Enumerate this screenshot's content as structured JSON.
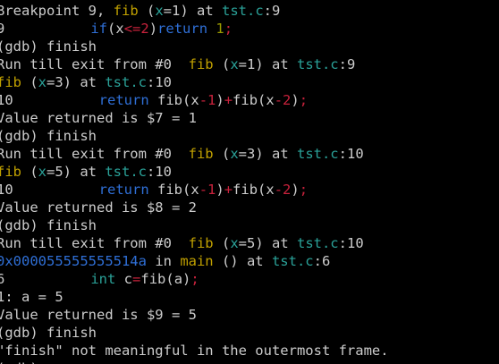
{
  "terminal": {
    "colors": {
      "background": "#000000",
      "default_text": "#cccccc",
      "function_name": "#c0a000",
      "variable": "#2aa198",
      "keyword": "#2f6fd6",
      "operator_number": "#c8223c",
      "number_literal": "#9a9a00"
    },
    "lines": [
      [
        {
          "t": "Breakpoint 9, ",
          "c": "default"
        },
        {
          "t": "fib",
          "c": "yellow"
        },
        {
          "t": " (",
          "c": "default"
        },
        {
          "t": "x",
          "c": "cyan"
        },
        {
          "t": "=1) at ",
          "c": "default"
        },
        {
          "t": "tst.c",
          "c": "cyan"
        },
        {
          "t": ":9",
          "c": "default"
        }
      ],
      [
        {
          "t": "9",
          "c": "default"
        },
        {
          "gap": true
        },
        {
          "t": "if",
          "c": "blue"
        },
        {
          "t": "(",
          "c": "default"
        },
        {
          "t": "x",
          "c": "default"
        },
        {
          "t": "<=2",
          "c": "red"
        },
        {
          "t": ")",
          "c": "default"
        },
        {
          "t": "return",
          "c": "blue"
        },
        {
          "t": " ",
          "c": "default"
        },
        {
          "t": "1",
          "c": "olive"
        },
        {
          "t": ";",
          "c": "red"
        }
      ],
      [
        {
          "t": "(gdb) finish",
          "c": "default"
        }
      ],
      [
        {
          "t": "Run till exit from #0  ",
          "c": "default"
        },
        {
          "t": "fib",
          "c": "yellow"
        },
        {
          "t": " (",
          "c": "default"
        },
        {
          "t": "x",
          "c": "cyan"
        },
        {
          "t": "=1) at ",
          "c": "default"
        },
        {
          "t": "tst.c",
          "c": "cyan"
        },
        {
          "t": ":9",
          "c": "default"
        }
      ],
      [
        {
          "t": "fib",
          "c": "yellow"
        },
        {
          "t": " (",
          "c": "default"
        },
        {
          "t": "x",
          "c": "cyan"
        },
        {
          "t": "=3) at ",
          "c": "default"
        },
        {
          "t": "tst.c",
          "c": "cyan"
        },
        {
          "t": ":10",
          "c": "default"
        }
      ],
      [
        {
          "t": "10",
          "c": "default"
        },
        {
          "gap": true
        },
        {
          "t": "return",
          "c": "blue"
        },
        {
          "t": " fib(",
          "c": "default"
        },
        {
          "t": "x",
          "c": "default"
        },
        {
          "t": "-1",
          "c": "red"
        },
        {
          "t": ")",
          "c": "default"
        },
        {
          "t": "+",
          "c": "red"
        },
        {
          "t": "fib(",
          "c": "default"
        },
        {
          "t": "x",
          "c": "default"
        },
        {
          "t": "-2",
          "c": "red"
        },
        {
          "t": ")",
          "c": "default"
        },
        {
          "t": ";",
          "c": "red"
        }
      ],
      [
        {
          "t": "Value returned is $7 = 1",
          "c": "default"
        }
      ],
      [
        {
          "t": "(gdb) finish",
          "c": "default"
        }
      ],
      [
        {
          "t": "Run till exit from #0  ",
          "c": "default"
        },
        {
          "t": "fib",
          "c": "yellow"
        },
        {
          "t": " (",
          "c": "default"
        },
        {
          "t": "x",
          "c": "cyan"
        },
        {
          "t": "=3) at ",
          "c": "default"
        },
        {
          "t": "tst.c",
          "c": "cyan"
        },
        {
          "t": ":10",
          "c": "default"
        }
      ],
      [
        {
          "t": "fib",
          "c": "yellow"
        },
        {
          "t": " (",
          "c": "default"
        },
        {
          "t": "x",
          "c": "cyan"
        },
        {
          "t": "=5) at ",
          "c": "default"
        },
        {
          "t": "tst.c",
          "c": "cyan"
        },
        {
          "t": ":10",
          "c": "default"
        }
      ],
      [
        {
          "t": "10",
          "c": "default"
        },
        {
          "gap": true
        },
        {
          "t": "return",
          "c": "blue"
        },
        {
          "t": " fib(",
          "c": "default"
        },
        {
          "t": "x",
          "c": "default"
        },
        {
          "t": "-1",
          "c": "red"
        },
        {
          "t": ")",
          "c": "default"
        },
        {
          "t": "+",
          "c": "red"
        },
        {
          "t": "fib(",
          "c": "default"
        },
        {
          "t": "x",
          "c": "default"
        },
        {
          "t": "-2",
          "c": "red"
        },
        {
          "t": ")",
          "c": "default"
        },
        {
          "t": ";",
          "c": "red"
        }
      ],
      [
        {
          "t": "Value returned is $8 = 2",
          "c": "default"
        }
      ],
      [
        {
          "t": "(gdb) finish",
          "c": "default"
        }
      ],
      [
        {
          "t": "Run till exit from #0  ",
          "c": "default"
        },
        {
          "t": "fib",
          "c": "yellow"
        },
        {
          "t": " (",
          "c": "default"
        },
        {
          "t": "x",
          "c": "cyan"
        },
        {
          "t": "=5) at ",
          "c": "default"
        },
        {
          "t": "tst.c",
          "c": "cyan"
        },
        {
          "t": ":10",
          "c": "default"
        }
      ],
      [
        {
          "t": "0x000055555555514a",
          "c": "addr"
        },
        {
          "t": " in ",
          "c": "default"
        },
        {
          "t": "main",
          "c": "yellow"
        },
        {
          "t": " () at ",
          "c": "default"
        },
        {
          "t": "tst.c",
          "c": "cyan"
        },
        {
          "t": ":6",
          "c": "default"
        }
      ],
      [
        {
          "t": "6",
          "c": "default"
        },
        {
          "gap": true
        },
        {
          "t": "int",
          "c": "cyan"
        },
        {
          "t": " c",
          "c": "default"
        },
        {
          "t": "=",
          "c": "red"
        },
        {
          "t": "fib(",
          "c": "default"
        },
        {
          "t": "a",
          "c": "default"
        },
        {
          "t": ")",
          "c": "default"
        },
        {
          "t": ";",
          "c": "red"
        }
      ],
      [
        {
          "t": "1: a = 5",
          "c": "default"
        }
      ],
      [
        {
          "t": "Value returned is $9 = 5",
          "c": "default"
        }
      ],
      [
        {
          "t": "(gdb) finish",
          "c": "default"
        }
      ],
      [
        {
          "t": "\"finish\" not meaningful in the outermost frame.",
          "c": "default"
        }
      ],
      [
        {
          "t": "(gdb) ",
          "c": "default"
        }
      ]
    ]
  }
}
